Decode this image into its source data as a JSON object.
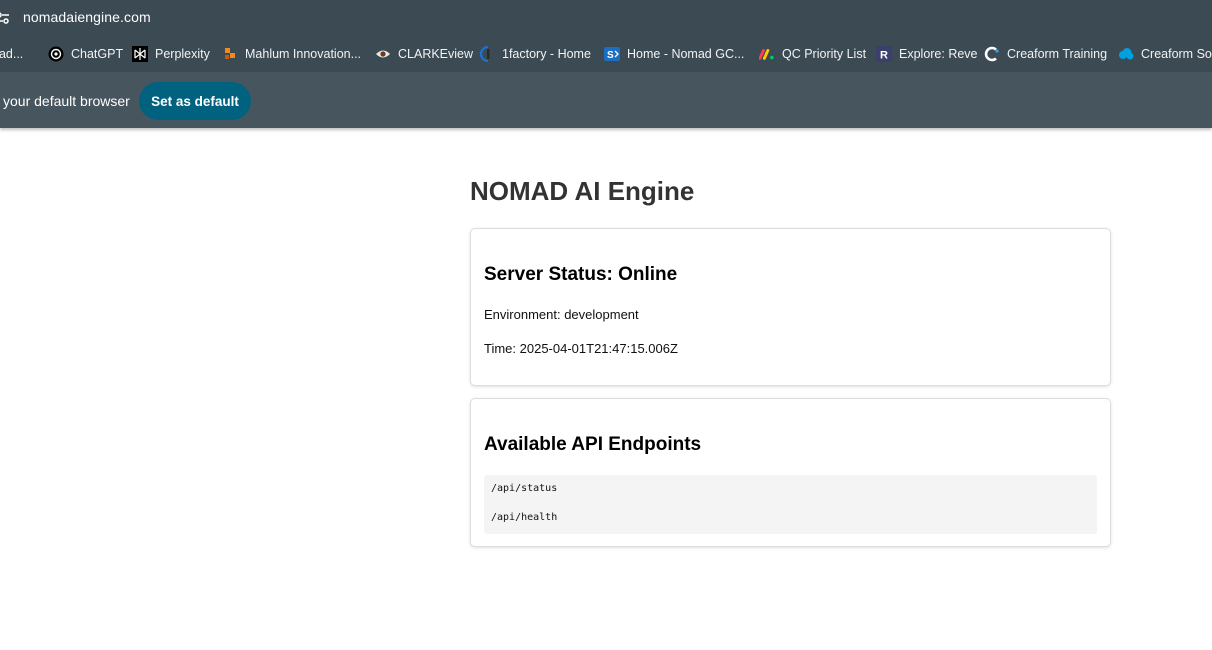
{
  "browser": {
    "url": "nomadaiengine.com",
    "bookmarks": [
      {
        "label": "nad...",
        "icon": "folder-icon"
      },
      {
        "label": "ChatGPT",
        "icon": "chatgpt-icon"
      },
      {
        "label": "Perplexity",
        "icon": "perplexity-icon"
      },
      {
        "label": "Mahlum Innovation...",
        "icon": "mahlum-icon"
      },
      {
        "label": "CLARKEview",
        "icon": "eye-icon"
      },
      {
        "label": "1factory - Home",
        "icon": "1factory-icon"
      },
      {
        "label": "Home - Nomad GC...",
        "icon": "sharepoint-icon"
      },
      {
        "label": "QC Priority List",
        "icon": "monday-icon"
      },
      {
        "label": "Explore: Reve",
        "icon": "reve-icon"
      },
      {
        "label": "Creaform Training",
        "icon": "creaform-icon"
      },
      {
        "label": "Creaform Soft",
        "icon": "salesforce-cloud-icon"
      }
    ],
    "infobar": {
      "text": "your default browser",
      "button": "Set as default"
    }
  },
  "page": {
    "title": "NOMAD AI Engine",
    "status_card": {
      "heading": "Server Status: Online",
      "environment": "Environment: development",
      "time": "Time: 2025-04-01T21:47:15.006Z"
    },
    "endpoints_card": {
      "heading": "Available API Endpoints",
      "endpoints": [
        "/api/status",
        "/api/health"
      ]
    }
  },
  "colors": {
    "chrome": "#3c4a54",
    "infobar": "#47555f",
    "accent_button": "#00627f"
  }
}
